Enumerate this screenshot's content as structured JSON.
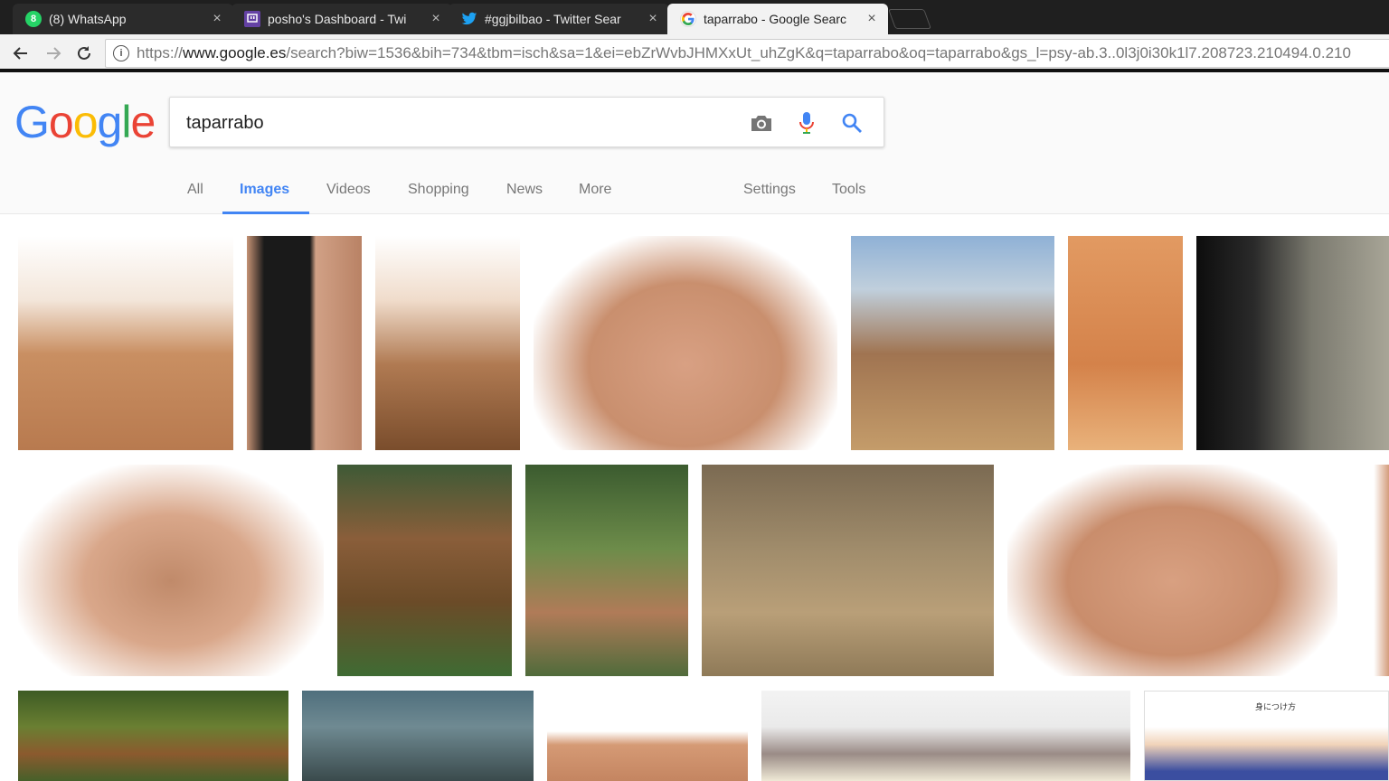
{
  "tabs": [
    {
      "title": "(8) WhatsApp",
      "favicon": "whatsapp-icon",
      "badge": "8",
      "color": "#25d366"
    },
    {
      "title": "posho's Dashboard - Twi",
      "favicon": "twitch-icon",
      "color": "#6441a4"
    },
    {
      "title": "#ggjbilbao - Twitter Sear",
      "favicon": "twitter-icon",
      "color": "#1da1f2"
    },
    {
      "title": "taparrabo - Google Searc",
      "favicon": "google-icon",
      "color": "#4285f4"
    }
  ],
  "close_glyph": "×",
  "url": {
    "scheme": "https://",
    "host": "www.google.es",
    "path": "/search?biw=1536&bih=734&tbm=isch&sa=1&ei=ebZrWvbJHMXxUt_uhZgK&q=taparrabo&oq=taparrabo&gs_l=psy-ab.3..0l3j0i30k1l7.208723.210494.0.210"
  },
  "logo_letters": [
    {
      "ch": "G",
      "color": "#4285f4"
    },
    {
      "ch": "o",
      "color": "#ea4335"
    },
    {
      "ch": "o",
      "color": "#fbbc05"
    },
    {
      "ch": "g",
      "color": "#4285f4"
    },
    {
      "ch": "l",
      "color": "#34a853"
    },
    {
      "ch": "e",
      "color": "#ea4335"
    }
  ],
  "search": {
    "query": "taparrabo"
  },
  "nav": {
    "all": "All",
    "images": "Images",
    "videos": "Videos",
    "shopping": "Shopping",
    "news": "News",
    "more": "More",
    "settings": "Settings",
    "tools": "Tools"
  },
  "results": [
    {
      "name": "result-image-1",
      "bg": "linear-gradient(180deg,#fff 0%,#f3e6da 30%,#c98f62 55%,#b87a4f 100%)"
    },
    {
      "name": "result-image-2",
      "bg": "linear-gradient(90deg,#c59274 0%,#1a1a1a 15%,#1a1a1a 55%,#d1a186 60%,#b98265 100%)"
    },
    {
      "name": "result-image-3",
      "bg": "linear-gradient(180deg,#fff 0%,#f0dccb 30%,#b07a52 60%,#7a4d2c 100%)"
    },
    {
      "name": "result-image-4",
      "bg": "radial-gradient(ellipse at 50% 60%,#d8a083 0%,#c98f6e 45%,#fff 75%)"
    },
    {
      "name": "result-image-5",
      "bg": "linear-gradient(180deg,#8fb1d6 0%,#c0cfdc 25%,#a07451 55%,#c49c6a 100%)"
    },
    {
      "name": "result-image-6",
      "bg": "linear-gradient(180deg,#e29a62 0%,#d4824a 60%,#e9b27b 100%)"
    },
    {
      "name": "result-image-7",
      "bg": "linear-gradient(90deg,#0d0d0d 0%,#2a2a2a 30%,#7b7a6f 60%,#a8a597 100%)"
    },
    {
      "name": "result-image-8",
      "bg": "radial-gradient(ellipse at 50% 55%,#c08a6a 0%,#d9a78a 40%,#fff 75%)"
    },
    {
      "name": "result-image-9",
      "bg": "linear-gradient(180deg,#3e5a36 0%,#8a5e3a 35%,#6b4b28 65%,#3f6b33 100%)"
    },
    {
      "name": "result-image-10",
      "bg": "linear-gradient(180deg,#3b5b2f 0%,#6d8c4a 40%,#b07b58 70%,#506b3b 100%)"
    },
    {
      "name": "result-image-11",
      "bg": "linear-gradient(180deg,#7b6a52 0%,#a08c6b 40%,#b99f78 70%,#8f7a58 100%)"
    },
    {
      "name": "result-image-12",
      "bg": "radial-gradient(ellipse at 50% 55%,#d8a081 0%,#c98d6c 45%,#fff 75%)"
    },
    {
      "name": "result-image-13",
      "bg": "linear-gradient(90deg,#fff 0%,#fff 60%,#d49d7c 100%)"
    },
    {
      "name": "result-image-14",
      "bg": "linear-gradient(180deg,#3d5b24 0%,#6a7f32 40%,#8b5a2e 70%,#46602a 100%)"
    },
    {
      "name": "result-image-15",
      "bg": "linear-gradient(180deg,#4f6f7d 0%,#6f8a92 40%,#3a4a4c 100%)"
    },
    {
      "name": "result-image-16",
      "bg": "linear-gradient(180deg,#fff 0%,#fff 45%,#d59a75 60%,#c48561 100%)"
    },
    {
      "name": "result-image-17",
      "bg": "linear-gradient(180deg,#f3f3f3 0%,#eaeaea 40%,#9a8b86 70%,#efe9d6 100%)"
    },
    {
      "name": "result-image-18",
      "bg": "linear-gradient(180deg,#fff 0%,#fff 40%,#f1d3b9 60%,#3b4ea0 90%)"
    }
  ],
  "result_caption_18": "身につけ方"
}
